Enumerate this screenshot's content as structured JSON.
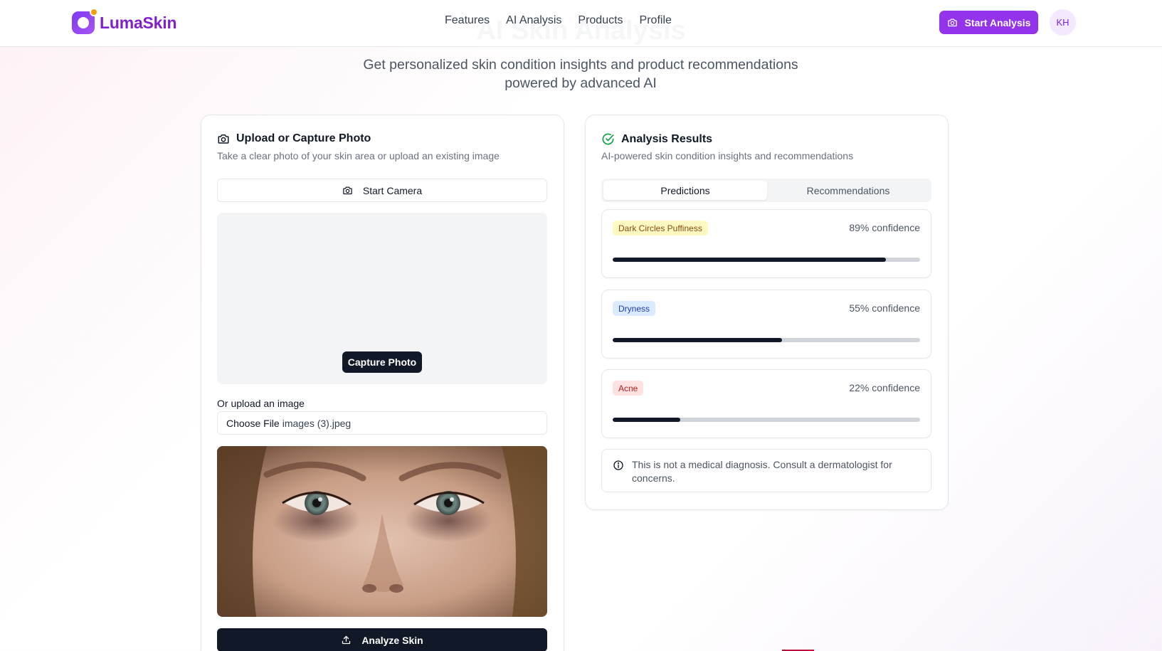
{
  "brand": {
    "name": "LumaSkin"
  },
  "header": {
    "ghost_title": "AI Skin Analysis",
    "nav": [
      "Features",
      "AI Analysis",
      "Products",
      "Profile"
    ],
    "cta_label": "Start Analysis",
    "avatar_initials": "KH"
  },
  "hero": {
    "subtitle_line1": "Get personalized skin condition insights and product recommendations",
    "subtitle_line2": "powered by advanced AI"
  },
  "upload_card": {
    "title": "Upload or Capture Photo",
    "subtitle": "Take a clear photo of your skin area or upload an existing image",
    "start_camera_label": "Start Camera",
    "capture_label": "Capture Photo",
    "upload_label": "Or upload an image",
    "choose_file_label": "Choose File",
    "file_name": "images (3).jpeg",
    "analyze_label": "Analyze Skin"
  },
  "results_card": {
    "title": "Analysis Results",
    "subtitle": "AI-powered skin condition insights and recommendations",
    "tabs": [
      {
        "label": "Predictions",
        "active": true
      },
      {
        "label": "Recommendations",
        "active": false
      }
    ],
    "predictions": [
      {
        "label": "Dark Circles Puffiness",
        "confidence_text": "89% confidence",
        "confidence": 0.89,
        "badge_bg": "#fef9c3",
        "badge_fg": "#854d0e"
      },
      {
        "label": "Dryness",
        "confidence_text": "55% confidence",
        "confidence": 0.55,
        "badge_bg": "#dbeafe",
        "badge_fg": "#1e40af"
      },
      {
        "label": "Acne",
        "confidence_text": "22% confidence",
        "confidence": 0.22,
        "badge_bg": "#fee2e2",
        "badge_fg": "#b91c1c"
      }
    ],
    "disclaimer": "This is not a medical diagnosis. Consult a dermatologist for concerns."
  },
  "colors": {
    "accent": "#9333ea",
    "dark": "#111827"
  }
}
